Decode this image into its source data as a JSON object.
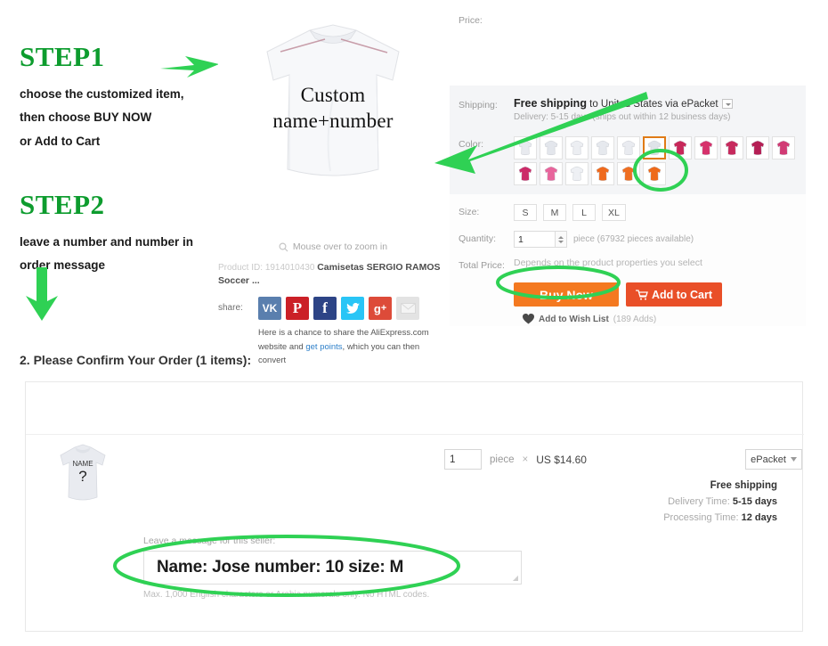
{
  "steps": {
    "step1": {
      "heading": "STEP1",
      "lines": [
        "choose the customized item,",
        "then choose BUY NOW",
        "or Add to Cart"
      ]
    },
    "step2": {
      "heading": "STEP2",
      "lines": [
        "leave a number and number in",
        "order message"
      ]
    },
    "arrow_right_1": "arrow-right-icon",
    "arrow_down_1": "arrow-down-icon"
  },
  "product": {
    "image_overlay": {
      "line1": "Custom",
      "line2": "name+number"
    },
    "zoom_hint": "Mouse over to zoom in",
    "zoom_icon": "magnifier-icon",
    "product_id_label": "Product ID:",
    "product_id": "1914010430",
    "title": "Camisetas SERGIO RAMOS Soccer ...",
    "share_label": "share:",
    "share_icons": [
      {
        "name": "vk-icon",
        "glyph": "VK",
        "color": "#5a7fae"
      },
      {
        "name": "pinterest-icon",
        "glyph": "P",
        "color": "#cb2027"
      },
      {
        "name": "facebook-icon",
        "glyph": "f",
        "color": "#2d4486"
      },
      {
        "name": "twitter-icon",
        "glyph": "bird",
        "color": "#29c5f6"
      },
      {
        "name": "google-plus-icon",
        "glyph": "g+",
        "color": "#dd4b39"
      },
      {
        "name": "email-icon",
        "glyph": "envelope",
        "color": "#e3e3e3"
      }
    ],
    "share_desc_a": "Here is a chance to share the AliExpress.com",
    "share_desc_b": "website and ",
    "share_link": "get points",
    "share_desc_c": ", which you can then convert"
  },
  "detail": {
    "price_label": "Price:",
    "price_value": "",
    "shipping_label": "Shipping:",
    "shipping_free": "Free shipping",
    "shipping_rest": " to United States via ePacket",
    "shipping_sub": "Delivery: 5-15 days (ships out within 12 business days)",
    "color_label": "Color:",
    "colors": [
      {
        "name": "white-1",
        "fill": "#e8eaef",
        "selected": false
      },
      {
        "name": "white-2",
        "fill": "#e3e6ec",
        "selected": false
      },
      {
        "name": "white-3",
        "fill": "#eceef2",
        "selected": false
      },
      {
        "name": "white-4",
        "fill": "#e6e9ee",
        "selected": false
      },
      {
        "name": "white-5",
        "fill": "#e9ebf0",
        "selected": false
      },
      {
        "name": "white-6",
        "fill": "#dfe3e9",
        "selected": true
      },
      {
        "name": "crimson-1",
        "fill": "#c8285a",
        "selected": false
      },
      {
        "name": "crimson-2",
        "fill": "#d6316b",
        "selected": false
      },
      {
        "name": "crimson-3",
        "fill": "#c72a5d",
        "selected": false
      },
      {
        "name": "magenta-1",
        "fill": "#b51f55",
        "selected": false
      },
      {
        "name": "pink-1",
        "fill": "#d13a74",
        "selected": false
      },
      {
        "name": "magenta-2",
        "fill": "#cc2a68",
        "selected": false
      },
      {
        "name": "pink-2",
        "fill": "#e8659c",
        "selected": false
      },
      {
        "name": "white-7",
        "fill": "#eef0f4",
        "selected": false
      },
      {
        "name": "orange-1",
        "fill": "#ef6a1d",
        "selected": false
      },
      {
        "name": "orange-2",
        "fill": "#ef6f22",
        "selected": false
      },
      {
        "name": "orange-3",
        "fill": "#ee6a1a",
        "selected": false
      }
    ],
    "size_label": "Size:",
    "sizes": [
      "S",
      "M",
      "L",
      "XL"
    ],
    "quantity_label": "Quantity:",
    "quantity_value": "1",
    "quantity_note": "piece (67932 pieces available)",
    "total_label": "Total Price:",
    "total_note": "Depends on the product properties you select",
    "buy_now": "Buy Now",
    "add_to_cart": "Add to Cart",
    "cart_icon": "cart-icon",
    "wish_icon": "heart-icon",
    "wish_label": "Add to Wish List",
    "wish_count": "(189 Adds)"
  },
  "confirm": {
    "title": "2. Please Confirm Your Order (1 items):",
    "thumb_name": "NAME",
    "thumb_number": "?",
    "qty_value": "1",
    "qty_unit": "piece",
    "multiply": "×",
    "unit_price": "US $14.60",
    "ship_method": "ePacket",
    "ship_caret": "chevron-down-icon",
    "free_shipping": "Free shipping",
    "delivery_label": "Delivery Time:",
    "delivery_value": "5-15 days",
    "processing_label": "Processing Time:",
    "processing_value": "12 days",
    "message_label": "Leave a message for this seller:",
    "message_value": "Name: Jose number: 10 size: M",
    "message_hint": "Max. 1,000 English characters or Arabic numerals only. No HTML codes."
  },
  "annotations": {
    "green": "#2fd154",
    "circle_color_swatch": "highlight-ellipse",
    "circle_buy_now": "highlight-ellipse",
    "circle_message": "highlight-ellipse"
  }
}
